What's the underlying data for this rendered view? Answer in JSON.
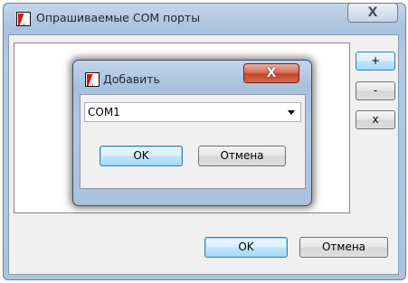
{
  "main_window": {
    "title": "Опрашиваемые COM порты",
    "close_label": "X",
    "side_buttons": {
      "add": "+",
      "remove": "-",
      "clear": "x"
    },
    "ok_label": "OK",
    "cancel_label": "Отмена"
  },
  "add_dialog": {
    "title": "Добавить",
    "close_label": "X",
    "port_select": {
      "value": "COM1"
    },
    "ok_label": "OK",
    "cancel_label": "Отмена"
  },
  "colors": {
    "title_bar": "#a9c1dc",
    "close_hot": "#c34427",
    "default_button": "#bee6fd",
    "app_icon": "#d21818"
  }
}
